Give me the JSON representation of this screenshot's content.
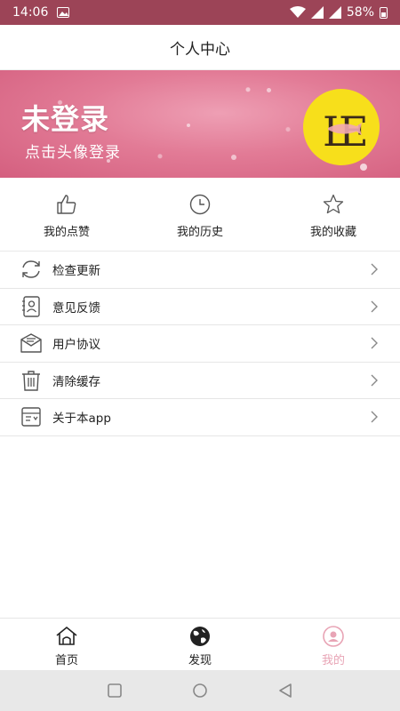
{
  "status_bar": {
    "time": "14:06",
    "battery": "58%"
  },
  "title": "个人中心",
  "banner": {
    "title": "未登录",
    "subtitle": "点击头像登录"
  },
  "quick_actions": [
    {
      "label": "我的点赞",
      "icon": "thumbs-up-icon"
    },
    {
      "label": "我的历史",
      "icon": "clock-icon"
    },
    {
      "label": "我的收藏",
      "icon": "star-icon"
    }
  ],
  "menu": [
    {
      "label": "检查更新",
      "icon": "refresh-icon"
    },
    {
      "label": "意见反馈",
      "icon": "feedback-icon"
    },
    {
      "label": "用户协议",
      "icon": "mail-icon"
    },
    {
      "label": "清除缓存",
      "icon": "trash-icon"
    },
    {
      "label": "关于本app",
      "icon": "info-card-icon"
    }
  ],
  "bottom_nav": [
    {
      "label": "首页",
      "icon": "home-icon",
      "active": false
    },
    {
      "label": "发现",
      "icon": "globe-icon",
      "active": false
    },
    {
      "label": "我的",
      "icon": "user-icon",
      "active": true
    }
  ],
  "colors": {
    "status_bar": "#9c4457",
    "accent_active": "#e8a4b5",
    "avatar_bg": "#f7df1b"
  }
}
